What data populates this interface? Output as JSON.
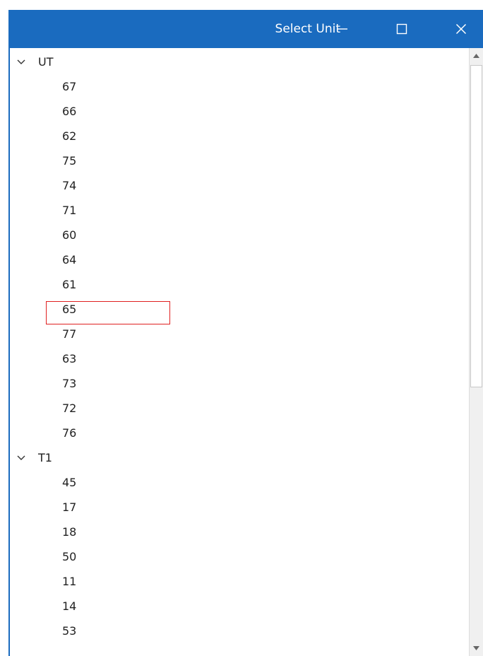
{
  "window": {
    "title": "Select Unit",
    "accent_color": "#1a6bbf",
    "highlight_color": "#e02020"
  },
  "titlebar_buttons": {
    "minimize_icon": "minimize-icon",
    "maximize_icon": "maximize-icon",
    "close_icon": "close-icon"
  },
  "tree": {
    "groups": [
      {
        "label": "UT",
        "expanded": true,
        "items": [
          "67",
          "66",
          "62",
          "75",
          "74",
          "71",
          "60",
          "64",
          "61",
          "65",
          "77",
          "63",
          "73",
          "72",
          "76"
        ]
      },
      {
        "label": "T1",
        "expanded": true,
        "items": [
          "45",
          "17",
          "18",
          "50",
          "11",
          "14",
          "53"
        ]
      }
    ],
    "highlighted_item": "65"
  }
}
